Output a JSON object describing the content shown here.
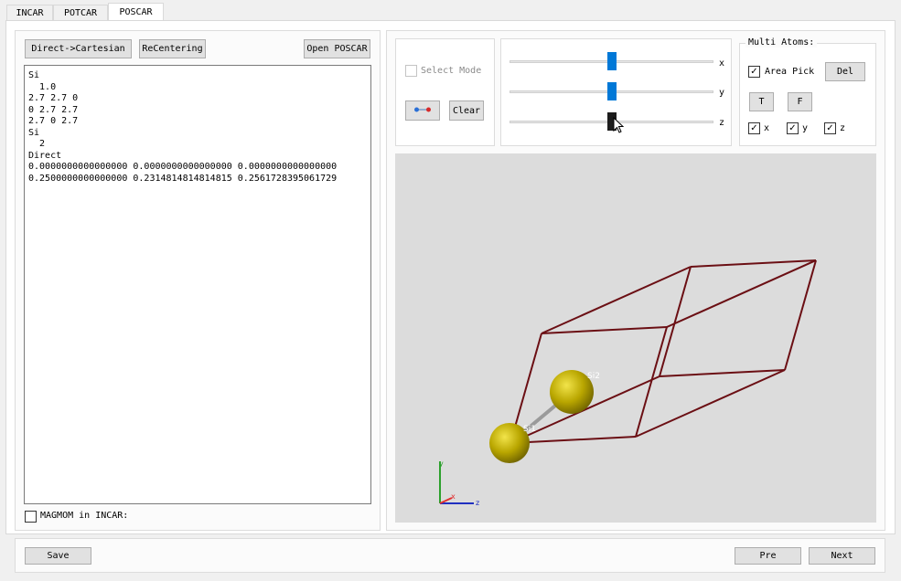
{
  "tabs": [
    {
      "label": "INCAR"
    },
    {
      "label": "POTCAR"
    },
    {
      "label": "POSCAR"
    }
  ],
  "left_panel": {
    "direct_to_cartesian_label": "Direct->Cartesian",
    "recentering_label": "ReCentering",
    "open_poscar_label": "Open POSCAR",
    "poscar_text": "Si\n  1.0\n2.7 2.7 0\n0 2.7 2.7\n2.7 0 2.7\nSi\n  2\nDirect\n0.0000000000000000 0.0000000000000000 0.0000000000000000\n0.2500000000000000 0.2314814814814815 0.2561728395061729",
    "magmom_label": "MAGMOM in INCAR:",
    "magmom_checked": false
  },
  "select_group": {
    "select_mode_label": "Select Mode",
    "select_mode_checked": false,
    "bond_icon": "bond-icon",
    "clear_label": "Clear"
  },
  "sliders": [
    {
      "axis": "x",
      "value": 0.5
    },
    {
      "axis": "y",
      "value": 0.5
    },
    {
      "axis": "z",
      "value": 0.5
    }
  ],
  "multi_atoms": {
    "title": "Multi Atoms:",
    "area_pick_label": "Area Pick",
    "area_pick_checked": true,
    "del_label": "Del",
    "t_label": "T",
    "f_label": "F",
    "x_label": "x",
    "y_label": "y",
    "z_label": "z",
    "x_checked": true,
    "y_checked": true,
    "z_checked": true
  },
  "viewer": {
    "atom_label_1": "Si1",
    "atom_label_2": "Si2",
    "axis_x": "x",
    "axis_y": "y",
    "axis_z": "z",
    "colors": {
      "background": "#dcdcdc",
      "cell_edge": "#6b0f14",
      "atom": "#c8b400",
      "bond": "#9a9a9a",
      "axis_x": "#e03030",
      "axis_y": "#2ca02c",
      "axis_z": "#2030c0"
    }
  },
  "footer": {
    "save_label": "Save",
    "pre_label": "Pre",
    "next_label": "Next"
  },
  "icons": {
    "check": "✓"
  }
}
